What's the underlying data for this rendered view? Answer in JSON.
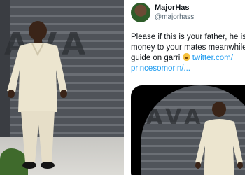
{
  "left_photo": {
    "gate_text": "AVA",
    "description_icon": "man-in-white-outfit-photo"
  },
  "tweet": {
    "author_name": "MajorHas",
    "author_handle": "@majorhass",
    "lines": [
      "Please if this is your father, he is s",
      "money to your mates meanwhile y",
      "guide on garri",
      "twitter.com/",
      "princesomorin/..."
    ],
    "emoji_icon": "grinning-sweat-emoji"
  },
  "right_photo": {
    "gate_text": "AVA"
  },
  "colors": {
    "link": "#1d9bf0",
    "text": "#0f1419",
    "muted": "#536471"
  }
}
